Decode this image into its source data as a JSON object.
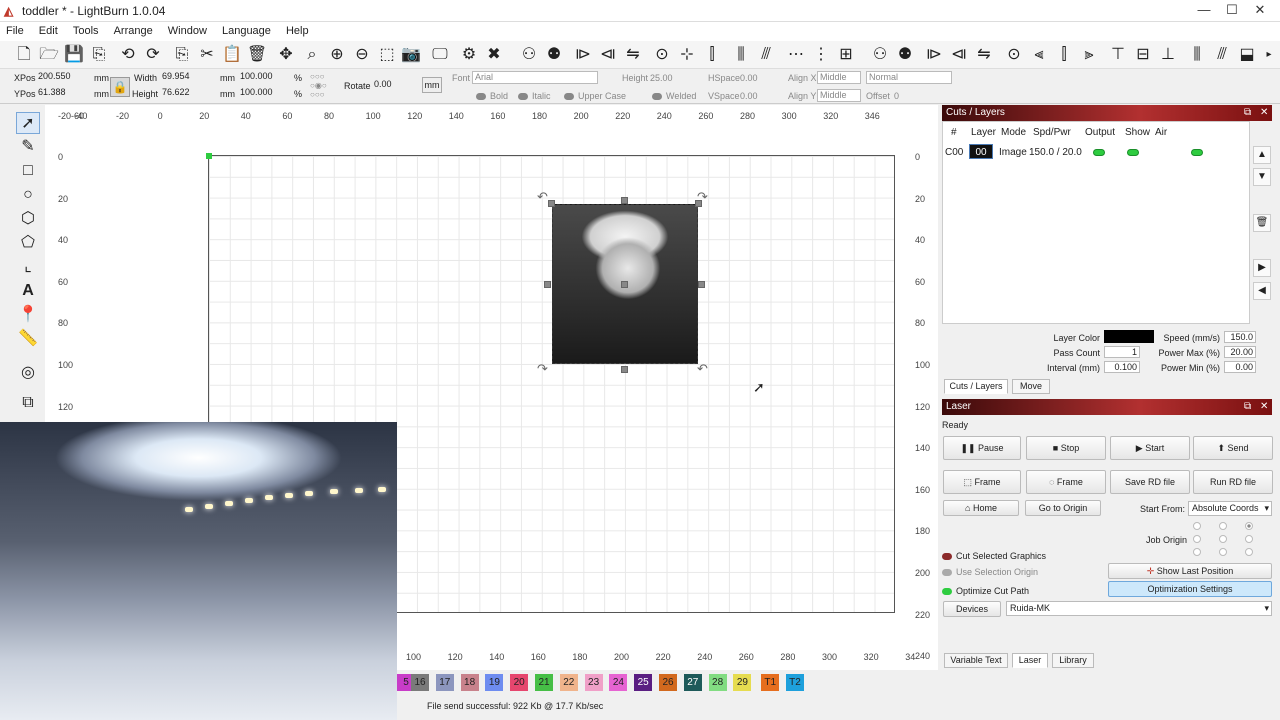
{
  "window": {
    "title": "toddler * - LightBurn 1.0.04",
    "minimize": "—",
    "maximize": "☐",
    "close": "✕"
  },
  "menu": [
    "File",
    "Edit",
    "Tools",
    "Arrange",
    "Window",
    "Language",
    "Help"
  ],
  "props": {
    "xpos_label": "XPos",
    "xpos": "200.550",
    "ypos_label": "YPos",
    "ypos": "61.388",
    "unit_mm": "mm",
    "width_label": "Width",
    "width": "69.954",
    "height_label": "Height",
    "height": "76.622",
    "scale_x": "100.000",
    "scale_y": "100.000",
    "pct": "%",
    "rotate_label": "Rotate",
    "rotate": "0.00",
    "mm_button": "mm",
    "font_label": "Font",
    "font": "Arial",
    "font_height_label": "Height",
    "font_height": "25.00",
    "hspace_label": "HSpace",
    "hspace": "0.00",
    "vspace_label": "VSpace",
    "vspace": "0.00",
    "alignx_label": "Align X",
    "alignx": "Middle",
    "aligny_label": "Align Y",
    "aligny": "Middle",
    "style": "Normal",
    "offset_label": "Offset",
    "offset": "0",
    "bold": "Bold",
    "italic": "Italic",
    "upper": "Upper Case",
    "welded": "Welded"
  },
  "rulers": {
    "top": [
      "-20-60",
      "-40",
      "-20",
      "0",
      "20",
      "40",
      "60",
      "80",
      "100",
      "120",
      "140",
      "160",
      "180",
      "200",
      "220",
      "240",
      "260",
      "280",
      "300",
      "320",
      "346"
    ],
    "left": [
      "0",
      "20",
      "40",
      "60",
      "80",
      "100",
      "120"
    ],
    "right": [
      "0",
      "20",
      "40",
      "60",
      "80",
      "100",
      "120",
      "140",
      "160",
      "180",
      "200",
      "220",
      "240"
    ],
    "bottom": [
      "100",
      "120",
      "140",
      "160",
      "180",
      "200",
      "220",
      "240",
      "260",
      "280",
      "300",
      "320",
      "34"
    ]
  },
  "palette": [
    {
      "label": "5",
      "color": "#c83cc8"
    },
    {
      "label": "16",
      "color": "#7a7a7a"
    },
    {
      "label": "17",
      "color": "#8c96be"
    },
    {
      "label": "18",
      "color": "#c8828c"
    },
    {
      "label": "19",
      "color": "#6e8cf0"
    },
    {
      "label": "20",
      "color": "#e6466e"
    },
    {
      "label": "21",
      "color": "#46be46"
    },
    {
      "label": "22",
      "color": "#f0b48c"
    },
    {
      "label": "23",
      "color": "#f0a0c8"
    },
    {
      "label": "24",
      "color": "#e664d2"
    },
    {
      "label": "25",
      "color": "#5a1e82"
    },
    {
      "label": "26",
      "color": "#d2691e"
    },
    {
      "label": "27",
      "color": "#1e5a5a"
    },
    {
      "label": "28",
      "color": "#82dc82"
    },
    {
      "label": "29",
      "color": "#e6dc50"
    },
    {
      "label": "T1",
      "color": "#e66e1e"
    },
    {
      "label": "T2",
      "color": "#1ea0dc"
    }
  ],
  "status": "File send successful: 922 Kb @ 17.7 Kb/sec",
  "cuts": {
    "title": "Cuts / Layers",
    "headers": [
      "#",
      "Layer",
      "Mode",
      "Spd/Pwr",
      "Output",
      "Show",
      "Air"
    ],
    "rows": [
      {
        "num": "C00",
        "layer": "00",
        "mode": "Image",
        "spdpwr": "150.0 / 20.0"
      }
    ],
    "layer_color_label": "Layer Color",
    "layer_color": "#000000",
    "speed_label": "Speed (mm/s)",
    "speed": "150.0",
    "pass_label": "Pass Count",
    "pass": "1",
    "pmax_label": "Power Max (%)",
    "pmax": "20.00",
    "interval_label": "Interval (mm)",
    "interval": "0.100",
    "pmin_label": "Power Min (%)",
    "pmin": "0.00",
    "tabs": [
      "Cuts / Layers",
      "Move"
    ]
  },
  "laser": {
    "title": "Laser",
    "state": "Ready",
    "pause": "Pause",
    "stop": "Stop",
    "start": "Start",
    "send": "Send",
    "frame1": "Frame",
    "frame2": "Frame",
    "save_rd": "Save RD file",
    "run_rd": "Run RD file",
    "home": "Home",
    "goto_origin": "Go to Origin",
    "start_from_label": "Start From:",
    "start_from": "Absolute Coords",
    "job_origin_label": "Job Origin",
    "cut_selected": "Cut Selected Graphics",
    "use_selection_origin": "Use Selection Origin",
    "optimize_cut": "Optimize Cut Path",
    "show_last": "Show Last Position",
    "optimization_settings": "Optimization Settings",
    "devices": "Devices",
    "device": "Ruida-MK",
    "bottom_tabs": [
      "Variable Text",
      "Laser",
      "Library"
    ]
  }
}
